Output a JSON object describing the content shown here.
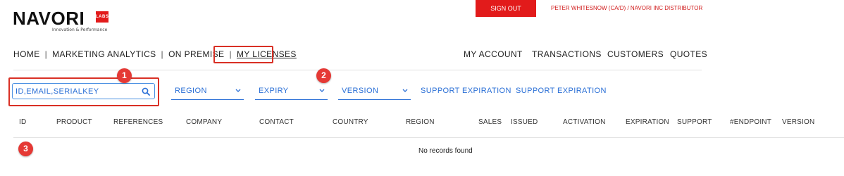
{
  "brand": {
    "name": "NAVORI",
    "badge": "LABS",
    "tagline": "Innovation & Performance"
  },
  "header": {
    "signout_label": "SIGN OUT",
    "user_info": "PETER WHITESNOW (CA/D) / NAVORI INC DISTRIBUTOR"
  },
  "nav": {
    "left": [
      "HOME",
      "MARKETING ANALYTICS",
      "ON PREMISE",
      "MY LICENSES"
    ],
    "separator": "|",
    "right": [
      "MY ACCOUNT",
      "TRANSACTIONS",
      "CUSTOMERS",
      "QUOTES"
    ],
    "active": "MY LICENSES"
  },
  "search": {
    "placeholder": "ID,EMAIL,SERIALKEY",
    "value": ""
  },
  "filters": [
    "REGION",
    "EXPIRY",
    "VERSION"
  ],
  "support_links": [
    "SUPPORT EXPIRATION",
    "SUPPORT EXPIRATION"
  ],
  "markers": [
    "1",
    "2",
    "3"
  ],
  "table": {
    "columns": [
      "ID",
      "PRODUCT",
      "REFERENCES",
      "COMPANY",
      "CONTACT",
      "COUNTRY",
      "REGION",
      "SALES",
      "ISSUED",
      "ACTIVATION",
      "EXPIRATION",
      "SUPPORT",
      "#ENDPOINT",
      "VERSION"
    ],
    "rows": [],
    "empty_message": "No records found"
  },
  "colors": {
    "accent_red": "#e21b1b",
    "link_blue": "#2a6fd6",
    "highlight": "#d93025"
  }
}
